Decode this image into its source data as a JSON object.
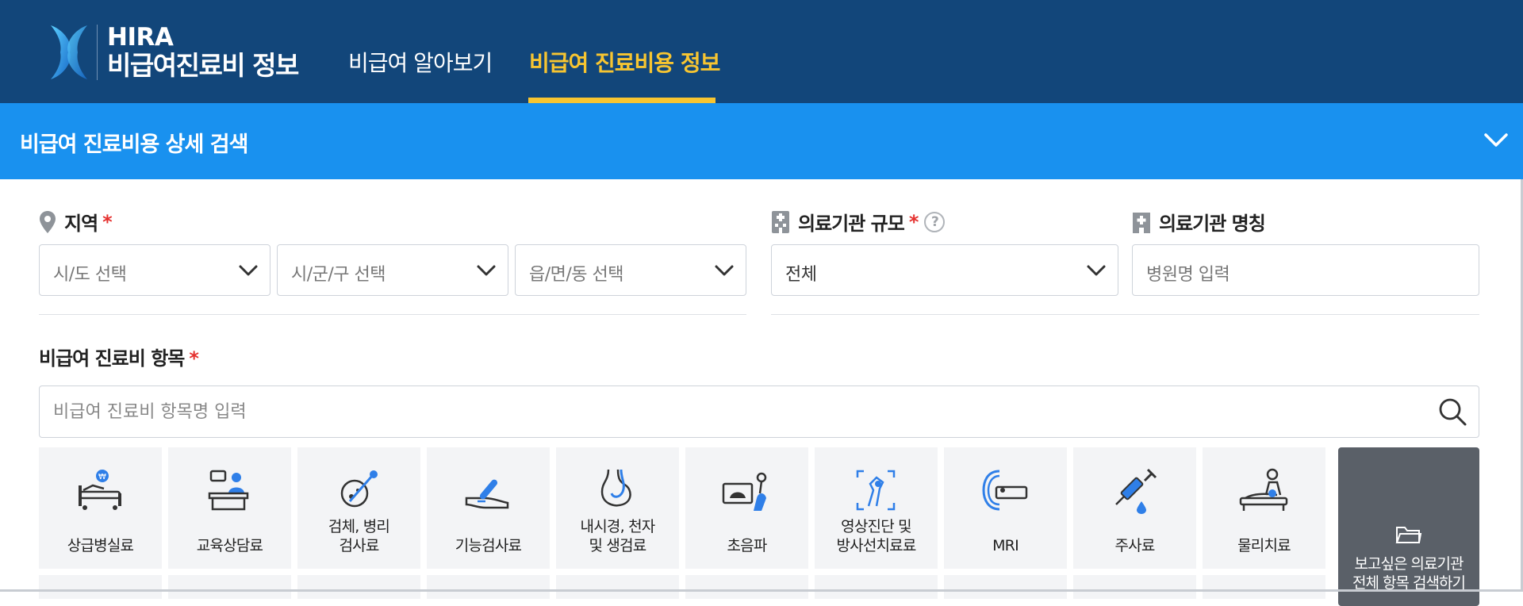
{
  "header": {
    "logo_line1": "HIRA",
    "logo_line2": "비급여진료비 정보",
    "tabs": [
      {
        "label": "비급여 알아보기",
        "active": false
      },
      {
        "label": "비급여 진료비용 정보",
        "active": true
      }
    ]
  },
  "banner": {
    "title": "비급여 진료비용 상세 검색",
    "icon": "chevron-down-icon"
  },
  "region": {
    "label": "지역",
    "required_mark": "*",
    "selects": [
      {
        "placeholder": "시/도 선택"
      },
      {
        "placeholder": "시/군/구 선택"
      },
      {
        "placeholder": "읍/면/동 선택"
      }
    ]
  },
  "institution_scale": {
    "label": "의료기관 규모",
    "required_mark": "*",
    "help": "?",
    "value": "전체"
  },
  "institution_name": {
    "label": "의료기관 명칭",
    "placeholder": "병원명 입력"
  },
  "items": {
    "label": "비급여 진료비 항목",
    "required_mark": "*",
    "search_placeholder": "비급여 진료비 항목명 입력",
    "categories": [
      {
        "label": "상급병실료",
        "icon": "hospital-bed-icon"
      },
      {
        "label": "교육상담료",
        "icon": "counseling-desk-icon"
      },
      {
        "label": "검체, 병리\n검사료",
        "icon": "specimen-swab-icon"
      },
      {
        "label": "기능검사료",
        "icon": "function-test-icon"
      },
      {
        "label": "내시경, 천자\n및 생검료",
        "icon": "endoscope-icon"
      },
      {
        "label": "초음파",
        "icon": "ultrasound-icon"
      },
      {
        "label": "영상진단 및\n방사선치료료",
        "icon": "xray-icon"
      },
      {
        "label": "MRI",
        "icon": "mri-scanner-icon"
      },
      {
        "label": "주사료",
        "icon": "syringe-icon"
      },
      {
        "label": "물리치료",
        "icon": "physical-therapy-icon"
      }
    ],
    "view_all": {
      "label": "보고싶은 의료기관\n전체 항목 검색하기",
      "icon": "folder-icon"
    }
  },
  "colors": {
    "header_bg": "#12467a",
    "banner_bg": "#1991ef",
    "accent_yellow": "#f7c531",
    "required_red": "#e5312f",
    "icon_blue": "#2f7fe8"
  }
}
